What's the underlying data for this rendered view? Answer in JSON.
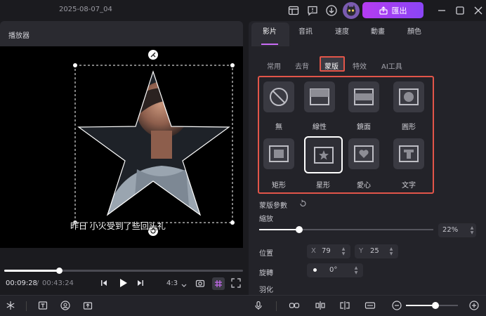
{
  "window": {
    "title": "2025-08-07_04",
    "export_label": "匯出"
  },
  "player": {
    "header": "播放器",
    "subtitle": "昨日 小火受到了些回头礼",
    "time_current": "00:09:28",
    "time_separator": "/",
    "time_total": "00:43:24",
    "ratio": "4:3",
    "progress": 0.23
  },
  "panel": {
    "main_tabs": [
      "影片",
      "音訊",
      "速度",
      "動畫",
      "顏色"
    ],
    "active_main_tab": "影片",
    "sub_tabs": [
      "常用",
      "去背",
      "蒙版",
      "特效",
      "AI工具"
    ],
    "active_sub_tab": "蒙版",
    "masks": [
      {
        "label": "無",
        "icon": "none-icon"
      },
      {
        "label": "線性",
        "icon": "linear-icon"
      },
      {
        "label": "鏡面",
        "icon": "mirror-icon"
      },
      {
        "label": "圓形",
        "icon": "circle-icon"
      },
      {
        "label": "矩形",
        "icon": "rectangle-icon"
      },
      {
        "label": "星形",
        "icon": "star-icon"
      },
      {
        "label": "愛心",
        "icon": "heart-icon"
      },
      {
        "label": "文字",
        "icon": "text-icon"
      }
    ],
    "active_mask": "星形",
    "mask_params_label": "蒙版參數",
    "zoom_label": "縮放",
    "zoom_value": "22",
    "zoom_unit": "%",
    "zoom_fraction": 0.22,
    "position_label": "位置",
    "x_label": "X",
    "x_value": "79",
    "y_label": "Y",
    "y_value": "25",
    "rotation_label": "旋轉",
    "rotation_value": "0°",
    "feather_label": "羽化"
  },
  "colors": {
    "accent": "#b53cf2",
    "highlight_border": "#e25549",
    "background": "#1b1b1f"
  }
}
